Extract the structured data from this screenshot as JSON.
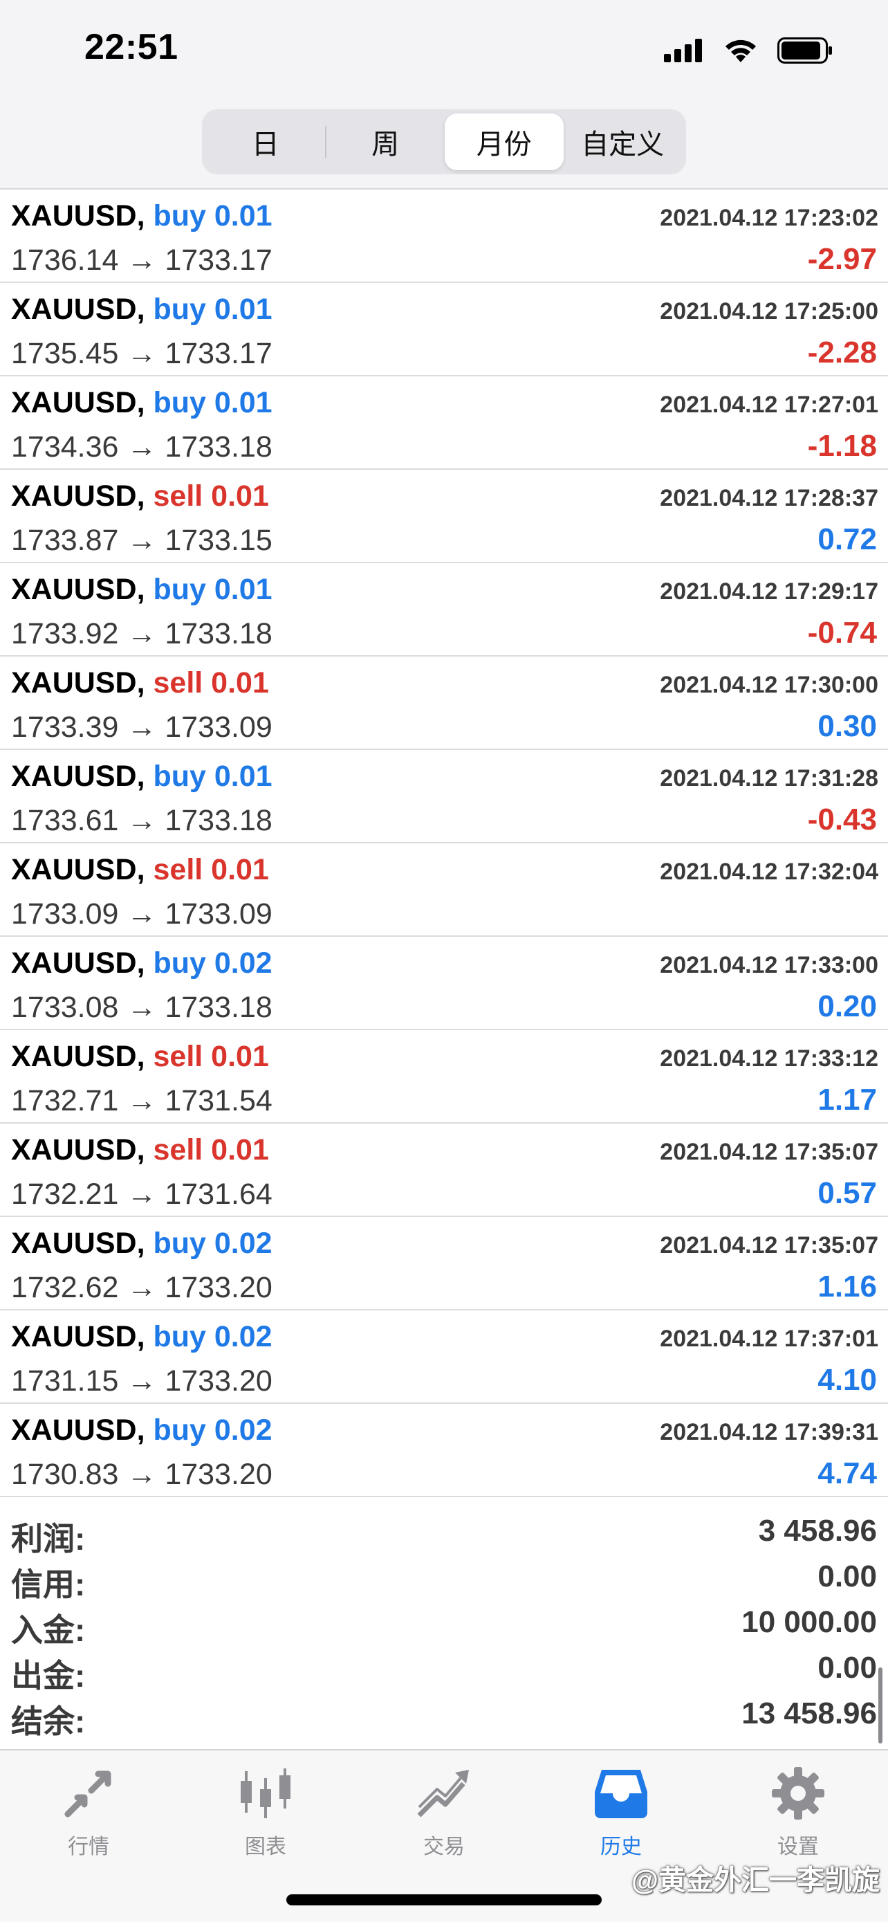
{
  "status_bar": {
    "time": "22:51"
  },
  "segmented": {
    "items": [
      {
        "label": "日",
        "active": false
      },
      {
        "label": "周",
        "active": false
      },
      {
        "label": "月份",
        "active": true
      },
      {
        "label": "自定义",
        "active": false
      }
    ]
  },
  "deals": [
    {
      "symbol": "XAUUSD,",
      "side": "buy",
      "volume": "0.01",
      "time": "2021.04.12 17:23:02",
      "open": "1736.14",
      "close": "1733.17",
      "profit": "-2.97"
    },
    {
      "symbol": "XAUUSD,",
      "side": "buy",
      "volume": "0.01",
      "time": "2021.04.12 17:25:00",
      "open": "1735.45",
      "close": "1733.17",
      "profit": "-2.28"
    },
    {
      "symbol": "XAUUSD,",
      "side": "buy",
      "volume": "0.01",
      "time": "2021.04.12 17:27:01",
      "open": "1734.36",
      "close": "1733.18",
      "profit": "-1.18"
    },
    {
      "symbol": "XAUUSD,",
      "side": "sell",
      "volume": "0.01",
      "time": "2021.04.12 17:28:37",
      "open": "1733.87",
      "close": "1733.15",
      "profit": "0.72"
    },
    {
      "symbol": "XAUUSD,",
      "side": "buy",
      "volume": "0.01",
      "time": "2021.04.12 17:29:17",
      "open": "1733.92",
      "close": "1733.18",
      "profit": "-0.74"
    },
    {
      "symbol": "XAUUSD,",
      "side": "sell",
      "volume": "0.01",
      "time": "2021.04.12 17:30:00",
      "open": "1733.39",
      "close": "1733.09",
      "profit": "0.30"
    },
    {
      "symbol": "XAUUSD,",
      "side": "buy",
      "volume": "0.01",
      "time": "2021.04.12 17:31:28",
      "open": "1733.61",
      "close": "1733.18",
      "profit": "-0.43"
    },
    {
      "symbol": "XAUUSD,",
      "side": "sell",
      "volume": "0.01",
      "time": "2021.04.12 17:32:04",
      "open": "1733.09",
      "close": "1733.09",
      "profit": ""
    },
    {
      "symbol": "XAUUSD,",
      "side": "buy",
      "volume": "0.02",
      "time": "2021.04.12 17:33:00",
      "open": "1733.08",
      "close": "1733.18",
      "profit": "0.20"
    },
    {
      "symbol": "XAUUSD,",
      "side": "sell",
      "volume": "0.01",
      "time": "2021.04.12 17:33:12",
      "open": "1732.71",
      "close": "1731.54",
      "profit": "1.17"
    },
    {
      "symbol": "XAUUSD,",
      "side": "sell",
      "volume": "0.01",
      "time": "2021.04.12 17:35:07",
      "open": "1732.21",
      "close": "1731.64",
      "profit": "0.57"
    },
    {
      "symbol": "XAUUSD,",
      "side": "buy",
      "volume": "0.02",
      "time": "2021.04.12 17:35:07",
      "open": "1732.62",
      "close": "1733.20",
      "profit": "1.16"
    },
    {
      "symbol": "XAUUSD,",
      "side": "buy",
      "volume": "0.02",
      "time": "2021.04.12 17:37:01",
      "open": "1731.15",
      "close": "1733.20",
      "profit": "4.10"
    },
    {
      "symbol": "XAUUSD,",
      "side": "buy",
      "volume": "0.02",
      "time": "2021.04.12 17:39:31",
      "open": "1730.83",
      "close": "1733.20",
      "profit": "4.74"
    }
  ],
  "arrow": "→",
  "summary": [
    {
      "label": "利润:",
      "value": "3 458.96"
    },
    {
      "label": "信用:",
      "value": "0.00"
    },
    {
      "label": "入金:",
      "value": "10 000.00"
    },
    {
      "label": "出金:",
      "value": "0.00"
    },
    {
      "label": "结余:",
      "value": "13 458.96"
    }
  ],
  "tabbar": {
    "items": [
      {
        "label": "行情",
        "icon": "quotes-arrows-icon",
        "active": false
      },
      {
        "label": "图表",
        "icon": "candlestick-chart-icon",
        "active": false
      },
      {
        "label": "交易",
        "icon": "trade-trend-icon",
        "active": false
      },
      {
        "label": "历史",
        "icon": "history-inbox-icon",
        "active": true
      },
      {
        "label": "设置",
        "icon": "gear-icon",
        "active": false
      }
    ]
  },
  "watermark": "@黄金外汇一李凯旋",
  "colors": {
    "buy": "#1f7ae8",
    "sell": "#d9352d",
    "profit_positive": "#1f7ae8",
    "profit_negative": "#d9352d",
    "tab_active": "#1f7ae8",
    "tab_inactive": "#8e8e93"
  }
}
